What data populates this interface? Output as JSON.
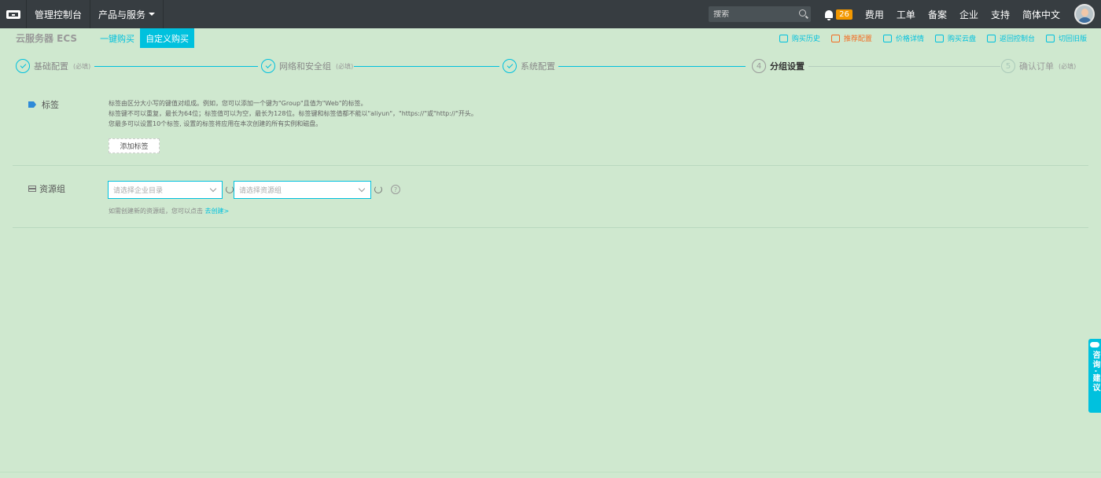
{
  "topbar": {
    "console": "管理控制台",
    "products": "产品与服务",
    "search_placeholder": "搜索",
    "notification_count": "26",
    "nav_right": [
      "费用",
      "工单",
      "备案",
      "企业",
      "支持",
      "简体中文"
    ]
  },
  "subheader": {
    "product": "云服务器 ECS",
    "tabs": [
      "一键购买",
      "自定义购买"
    ],
    "active_tab": "自定义购买",
    "tools": [
      "购买历史",
      "推荐配置",
      "价格详情",
      "购买云盘",
      "返回控制台",
      "切回旧版"
    ]
  },
  "steps": [
    {
      "num": "1",
      "label": "基础配置",
      "required": "(必填)",
      "state": "done"
    },
    {
      "num": "2",
      "label": "网络和安全组",
      "required": "(必填)",
      "state": "done"
    },
    {
      "num": "3",
      "label": "系统配置",
      "required": "",
      "state": "done"
    },
    {
      "num": "4",
      "label": "分组设置",
      "required": "",
      "state": "current"
    },
    {
      "num": "5",
      "label": "确认订单",
      "required": "(必填)",
      "state": "pending"
    }
  ],
  "tags": {
    "title": "标签",
    "desc1": "标签由区分大小写的键值对组成。例如，您可以添加一个键为\"Group\"且值为\"Web\"的标签。",
    "desc2": "标签键不可以重复，最长为64位；标签值可以为空，最长为128位。标签键和标签值都不能以\"aliyun\"，\"https://\"或\"http://\"开头。",
    "desc3": "您最多可以设置10个标签, 设置的标签将应用在本次创建的所有实例和磁盘。",
    "add_button": "添加标签"
  },
  "resource_group": {
    "title": "资源组",
    "enterprise_placeholder": "请选择企业目录",
    "group_placeholder": "请选择资源组",
    "help": "?",
    "hint": "如需创建新的资源组，您可以点击",
    "hint_link": "去创建>"
  },
  "consult": {
    "label": "咨询·建议"
  }
}
